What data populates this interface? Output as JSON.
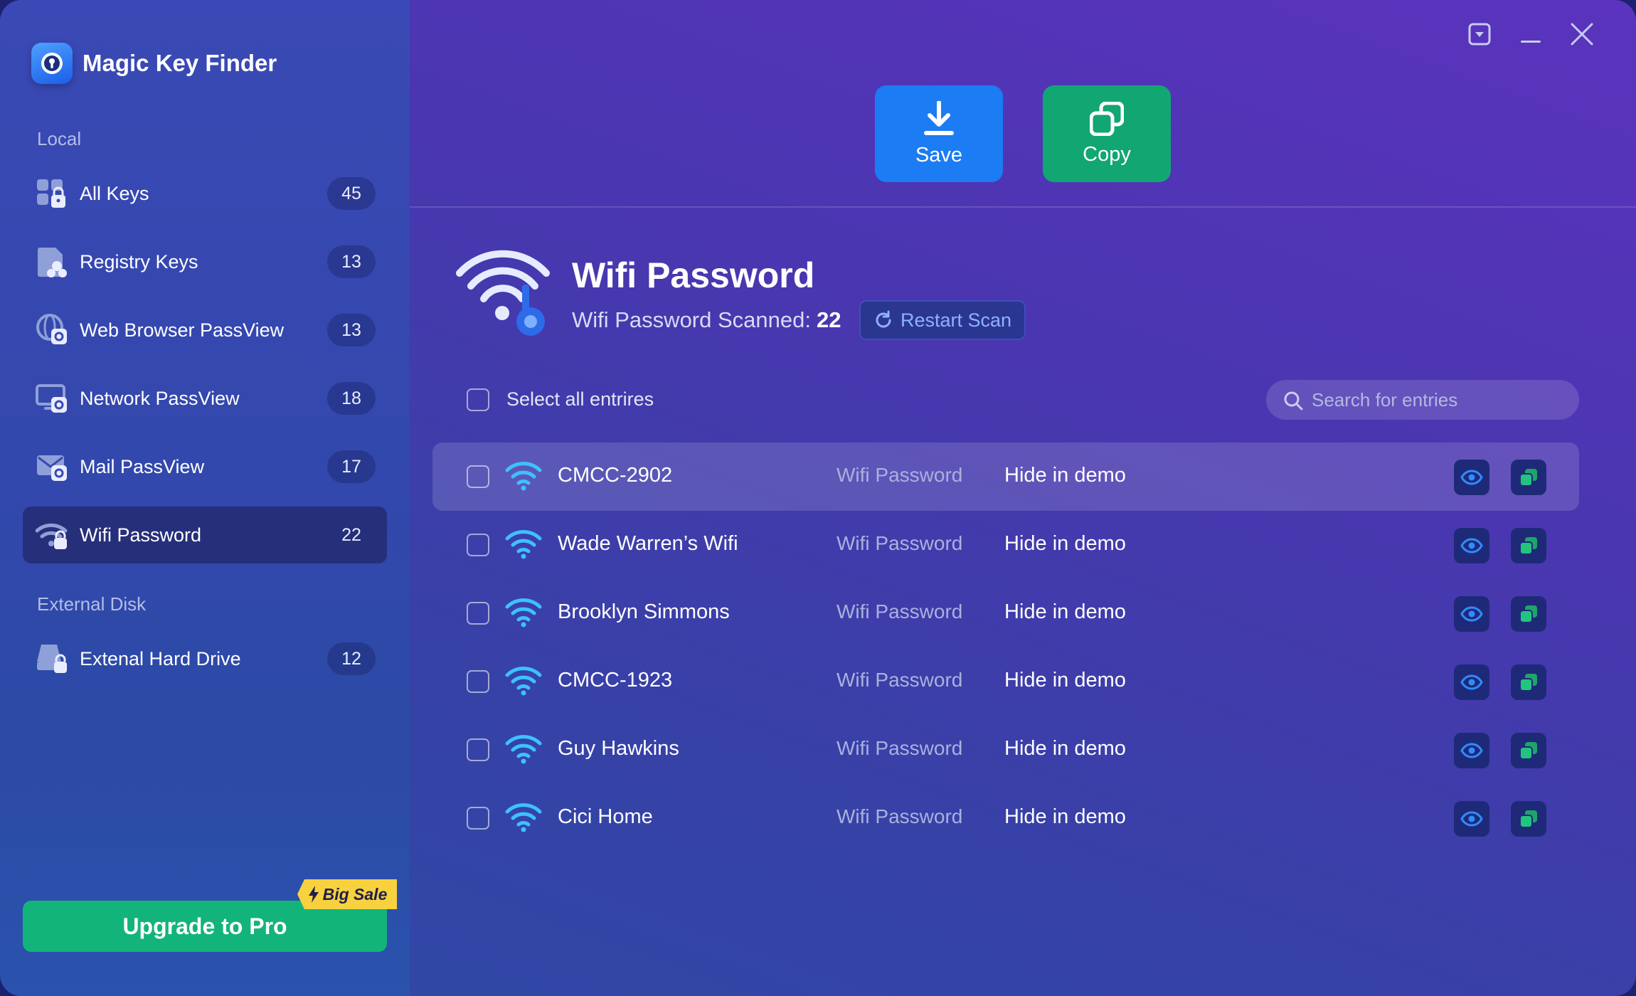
{
  "app": {
    "title": "Magic Key Finder"
  },
  "sidebar": {
    "local_label": "Local",
    "external_label": "External Disk",
    "items": [
      {
        "label": "All Keys",
        "count": "45",
        "icon": "grid-lock-icon"
      },
      {
        "label": "Registry Keys",
        "count": "13",
        "icon": "registry-file-icon"
      },
      {
        "label": "Web Browser PassView",
        "count": "13",
        "icon": "globe-lock-icon"
      },
      {
        "label": "Network PassView",
        "count": "18",
        "icon": "monitor-lock-icon"
      },
      {
        "label": "Mail PassView",
        "count": "17",
        "icon": "mail-lock-icon"
      },
      {
        "label": "Wifi Password",
        "count": "22",
        "icon": "wifi-lock-icon",
        "active": true
      }
    ],
    "external_items": [
      {
        "label": "Extenal Hard Drive",
        "count": "12",
        "icon": "drive-lock-icon"
      }
    ],
    "upgrade_label": "Upgrade to Pro",
    "sale_badge": "Big Sale"
  },
  "toolbar": {
    "save_label": "Save",
    "copy_label": "Copy"
  },
  "header": {
    "title": "Wifi Password",
    "scanned_label": "Wifi Password Scanned:",
    "scanned_count": "22",
    "restart_label": "Restart Scan"
  },
  "list": {
    "select_all_label": "Select all entrires",
    "search_placeholder": "Search for entries",
    "rows": [
      {
        "name": "CMCC-2902",
        "type": "Wifi Password",
        "password": "Hide in demo"
      },
      {
        "name": "Wade Warren’s Wifi",
        "type": "Wifi Password",
        "password": "Hide in demo"
      },
      {
        "name": "Brooklyn Simmons",
        "type": "Wifi Password",
        "password": "Hide in demo"
      },
      {
        "name": "CMCC-1923",
        "type": "Wifi Password",
        "password": "Hide in demo"
      },
      {
        "name": "Guy Hawkins",
        "type": "Wifi Password",
        "password": "Hide in demo"
      },
      {
        "name": "Cici Home",
        "type": "Wifi Password",
        "password": "Hide in demo"
      }
    ]
  },
  "colors": {
    "accent_blue": "#1b7cf4",
    "accent_green": "#12a673",
    "sale_yellow": "#f7d23e",
    "active_nav": "#262f7a"
  }
}
